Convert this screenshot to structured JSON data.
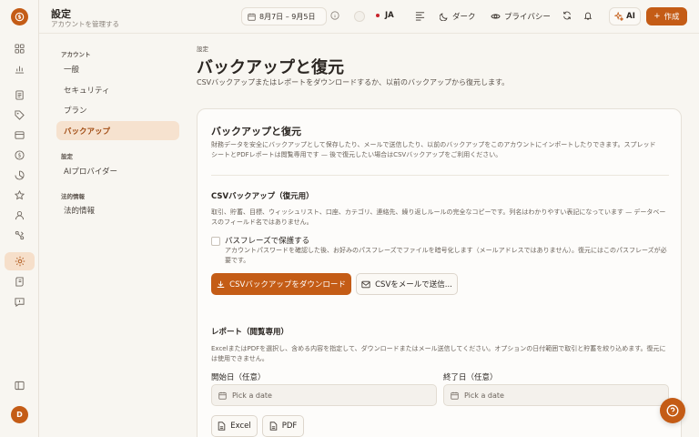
{
  "header": {
    "title": "設定",
    "subtitle": "アカウントを管理する",
    "date_range": "8月7日 – 9月5日",
    "language": "JA",
    "theme_label": "ダーク",
    "privacy_label": "プライバシー",
    "ai_label": "AI",
    "create_label": "作成"
  },
  "user": {
    "avatar_initial": "D"
  },
  "subnav": {
    "groups": [
      {
        "label": "アカウント",
        "items": [
          "一般",
          "セキュリティ",
          "プラン",
          "バックアップ"
        ]
      },
      {
        "label": "設定",
        "items": [
          "AIプロバイダー"
        ]
      },
      {
        "label": "法的情報",
        "items": [
          "法的情報"
        ]
      }
    ],
    "active": "バックアップ"
  },
  "page": {
    "breadcrumb": "設定",
    "title": "バックアップと復元",
    "subtitle": "CSVバックアップまたはレポートをダウンロードするか、以前のバックアップから復元します。"
  },
  "card": {
    "title": "バックアップと復元",
    "description": "財務データを安全にバックアップとして保存したり、メールで送信したり、以前のバックアップをこのアカウントにインポートしたりできます。スプレッドシートとPDFレポートは閲覧専用です — 後で復元したい場合はCSVバックアップをご利用ください。",
    "csv": {
      "title": "CSVバックアップ（復元用）",
      "description": "取引、貯蓄、目標、ウィッシュリスト、口座、カテゴリ、連絡先、繰り返しルールの完全なコピーです。列名はわかりやすい表記になっています — データベースのフィールド名ではありません。",
      "passphrase_label": "パスフレーズで保護する",
      "passphrase_desc": "アカウントパスワードを確認した後、お好みのパスフレーズでファイルを暗号化します（メールアドレスではありません）。復元にはこのパスフレーズが必要です。",
      "download_label": "CSVバックアップをダウンロード",
      "email_label": "CSVをメールで送信..."
    },
    "report": {
      "title": "レポート（閲覧専用）",
      "description": "ExcelまたはPDFを選択し、含める内容を指定して、ダウンロードまたはメール送信してください。オプションの日付範囲で取引と貯蓄を絞り込めます。復元には使用できません。",
      "start_label": "開始日（任意）",
      "end_label": "終了日（任意）",
      "date_placeholder": "Pick a date",
      "excel_label": "Excel",
      "pdf_label": "PDF"
    }
  },
  "colors": {
    "accent": "#c45c16",
    "active_bg": "#f6dfca"
  }
}
